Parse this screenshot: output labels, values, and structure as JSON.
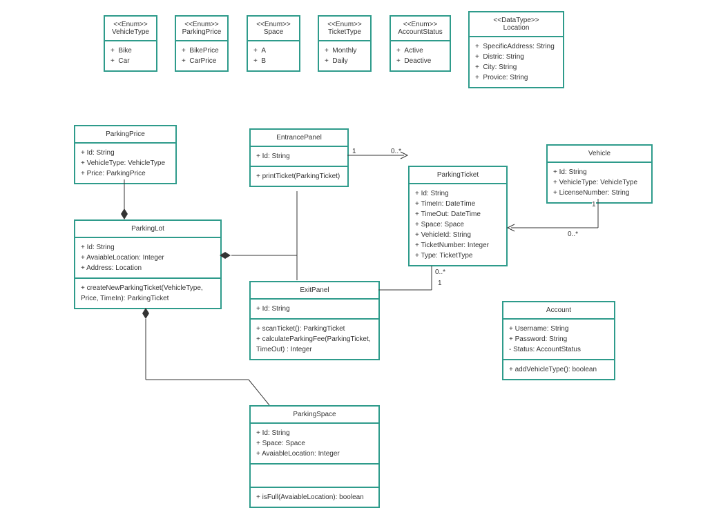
{
  "enums": {
    "vehicleType": {
      "stereotype": "<<Enum>>",
      "name": "VehicleType",
      "items": [
        "Bike",
        "Car"
      ]
    },
    "parkingPrice": {
      "stereotype": "<<Enum>>",
      "name": "ParkingPrice",
      "items": [
        "BikePrice",
        "CarPrice"
      ]
    },
    "space": {
      "stereotype": "<<Enum>>",
      "name": "Space",
      "items": [
        "A",
        "B"
      ]
    },
    "ticketType": {
      "stereotype": "<<Enum>>",
      "name": "TicketType",
      "items": [
        "Monthly",
        "Daily"
      ]
    },
    "accountStatus": {
      "stereotype": "<<Enum>>",
      "name": "AccountStatus",
      "items": [
        "Active",
        "Deactive"
      ]
    },
    "location": {
      "stereotype": "<<DataType>>",
      "name": "Location",
      "items": [
        "SpecificAddress: String",
        "Distric: String",
        "City: String",
        "Provice: String"
      ]
    }
  },
  "classes": {
    "parkingPriceClass": {
      "name": "ParkingPrice",
      "attrs": [
        "+  Id: String",
        "+  VehicleType: VehicleType",
        "+  Price: ParkingPrice"
      ]
    },
    "parkingLot": {
      "name": "ParkingLot",
      "attrs": [
        "+  Id: String",
        "+  AvaiableLocation: Integer",
        "+  Address: Location"
      ],
      "ops": [
        "+  createNewParkingTicket(VehicleType, Price, TimeIn): ParkingTicket"
      ]
    },
    "entrancePanel": {
      "name": "EntrancePanel",
      "attrs": [
        "+  Id: String"
      ],
      "ops": [
        "+  printTicket(ParkingTicket)"
      ]
    },
    "exitPanel": {
      "name": "ExitPanel",
      "attrs": [
        "+  Id: String"
      ],
      "ops": [
        "+  scanTicket(): ParkingTicket",
        "+  calculateParkingFee(ParkingTicket, TimeOut) : Integer"
      ]
    },
    "parkingTicket": {
      "name": "ParkingTicket",
      "attrs": [
        "+  Id: String",
        "+  TimeIn: DateTime",
        "+  TimeOut: DateTime",
        "+  Space: Space",
        "+  VehicleId: String",
        "+  TicketNumber: Integer",
        "+  Type: TicketType"
      ]
    },
    "vehicle": {
      "name": "Vehicle",
      "attrs": [
        "+  Id: String",
        "+  VehicleType: VehicleType",
        "+  LicenseNumber: String"
      ]
    },
    "account": {
      "name": "Account",
      "attrs": [
        "+  Username: String",
        "+  Password: String",
        "-  Status: AccountStatus"
      ],
      "ops": [
        "+  addVehicleType(): boolean"
      ]
    },
    "parkingSpace": {
      "name": "ParkingSpace",
      "attrs": [
        "+  Id: String",
        "+  Space: Space",
        "+  AvaiableLocation: Integer"
      ],
      "ops": [
        "+  isFull(AvaiableLocation): boolean"
      ]
    }
  },
  "multiplicities": {
    "entranceToTicket_left": "1",
    "entranceToTicket_right": "0..*",
    "exitToTicket_bottom": "1",
    "exitToTicket_top": "0..*",
    "vehicleToTicket_top": "1",
    "vehicleToTicket_bottom": "0..*"
  }
}
